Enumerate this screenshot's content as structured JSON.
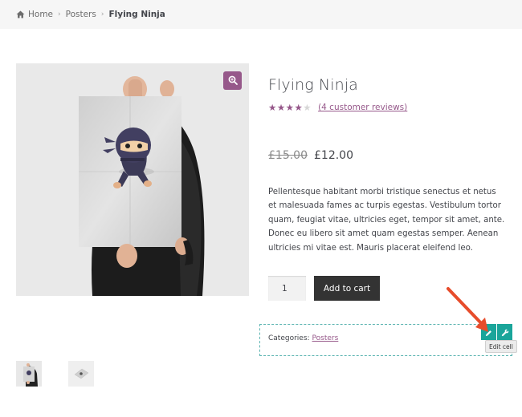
{
  "breadcrumb": {
    "home": "Home",
    "category": "Posters",
    "current": "Flying Ninja"
  },
  "product": {
    "title": "Flying Ninja",
    "rating": 4,
    "rating_max": 5,
    "reviews_link": "(4 customer reviews)",
    "old_price": "£15.00",
    "price": "£12.00",
    "description": "Pellentesque habitant morbi tristique senectus et netus et malesuada fames ac turpis egestas. Vestibulum tortor quam, feugiat vitae, ultricies eget, tempor sit amet, ante. Donec eu libero sit amet quam egestas semper. Aenean ultricies mi vitae est. Mauris placerat eleifend leo.",
    "quantity": "1",
    "add_to_cart_label": "Add to cart",
    "categories_label": "Categories:",
    "category_link": "Posters"
  },
  "editor": {
    "tooltip": "Edit cell"
  },
  "icons": {
    "home": "home-icon",
    "zoom": "magnifier-icon",
    "edit": "pencil-icon",
    "settings": "wrench-icon"
  },
  "colors": {
    "accent": "#96588a",
    "button_dark": "#333333",
    "editor_teal": "#1aa59a",
    "arrow": "#e74c2b"
  }
}
